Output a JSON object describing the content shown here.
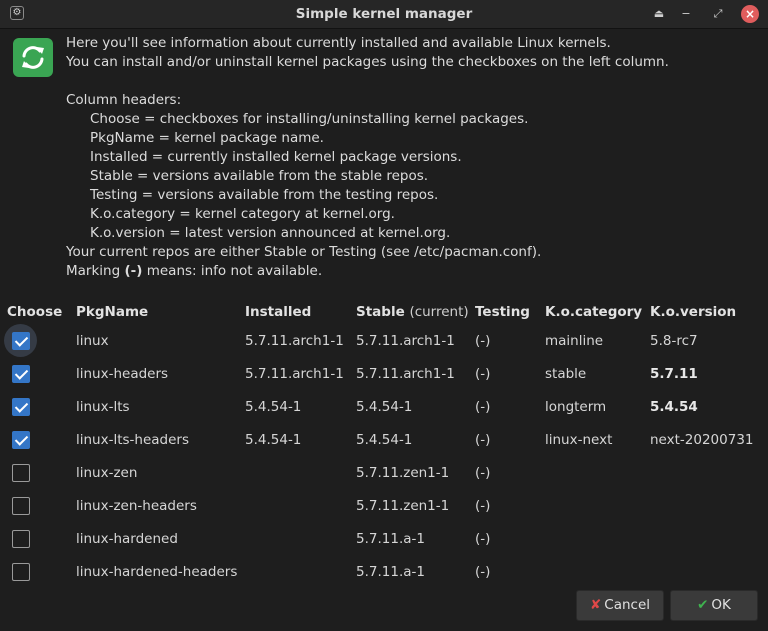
{
  "window": {
    "title": "Simple kernel manager"
  },
  "titlebar_icons": [
    "settings-icon",
    "keep-above-icon",
    "minimize-icon",
    "maximize-icon",
    "close-icon"
  ],
  "info": {
    "lines": [
      "Here you'll see information about currently installed and available Linux kernels.",
      "You can install and/or uninstall kernel packages using the checkboxes on the left column."
    ],
    "column_headers_title": "Column headers:",
    "column_desc": [
      "Choose = checkboxes for installing/uninstalling kernel packages.",
      "PkgName = kernel package name.",
      "Installed = currently installed kernel package versions.",
      "Stable = versions available from the stable repos.",
      "Testing = versions available from the testing repos.",
      "K.o.category = kernel category at kernel.org.",
      "K.o.version = latest version announced at kernel.org."
    ],
    "repos_note": "Your current repos are either Stable or Testing (see /etc/pacman.conf).",
    "marking_pre": "Marking ",
    "marking_bold": "(-)",
    "marking_post": " means: info not available."
  },
  "table": {
    "headers": {
      "choose": "Choose",
      "pkgname": "PkgName",
      "installed": "Installed",
      "stable": "Stable",
      "stable_suffix": "(current)",
      "testing": "Testing",
      "kocategory": "K.o.category",
      "koversion": "K.o.version"
    },
    "rows": [
      {
        "checked": true,
        "pkg": "linux",
        "installed": "5.7.11.arch1-1",
        "stable": "5.7.11.arch1-1",
        "testing": "(-)",
        "kocat": "mainline",
        "kover": "5.8-rc7"
      },
      {
        "checked": true,
        "pkg": "linux-headers",
        "installed": "5.7.11.arch1-1",
        "stable": "5.7.11.arch1-1",
        "testing": "(-)",
        "kocat": "stable",
        "kover": "5.7.11"
      },
      {
        "checked": true,
        "pkg": "linux-lts",
        "installed": "5.4.54-1",
        "stable": "5.4.54-1",
        "testing": "(-)",
        "kocat": "longterm",
        "kover": "5.4.54"
      },
      {
        "checked": true,
        "pkg": "linux-lts-headers",
        "installed": "5.4.54-1",
        "stable": "5.4.54-1",
        "testing": "(-)",
        "kocat": "linux-next",
        "kover": "next-20200731"
      },
      {
        "checked": false,
        "pkg": "linux-zen",
        "installed": "",
        "stable": "5.7.11.zen1-1",
        "testing": "(-)",
        "kocat": "",
        "kover": ""
      },
      {
        "checked": false,
        "pkg": "linux-zen-headers",
        "installed": "",
        "stable": "5.7.11.zen1-1",
        "testing": "(-)",
        "kocat": "",
        "kover": ""
      },
      {
        "checked": false,
        "pkg": "linux-hardened",
        "installed": "",
        "stable": "5.7.11.a-1",
        "testing": "(-)",
        "kocat": "",
        "kover": ""
      },
      {
        "checked": false,
        "pkg": "linux-hardened-headers",
        "installed": "",
        "stable": "5.7.11.a-1",
        "testing": "(-)",
        "kocat": "",
        "kover": ""
      }
    ]
  },
  "buttons": {
    "cancel": "Cancel",
    "ok": "OK"
  },
  "colors": {
    "background": "#1e1e1e",
    "accent": "#3476c7",
    "icon_green": "#3aa553",
    "cancel_red": "#e04848",
    "ok_green": "#3fb34f"
  }
}
